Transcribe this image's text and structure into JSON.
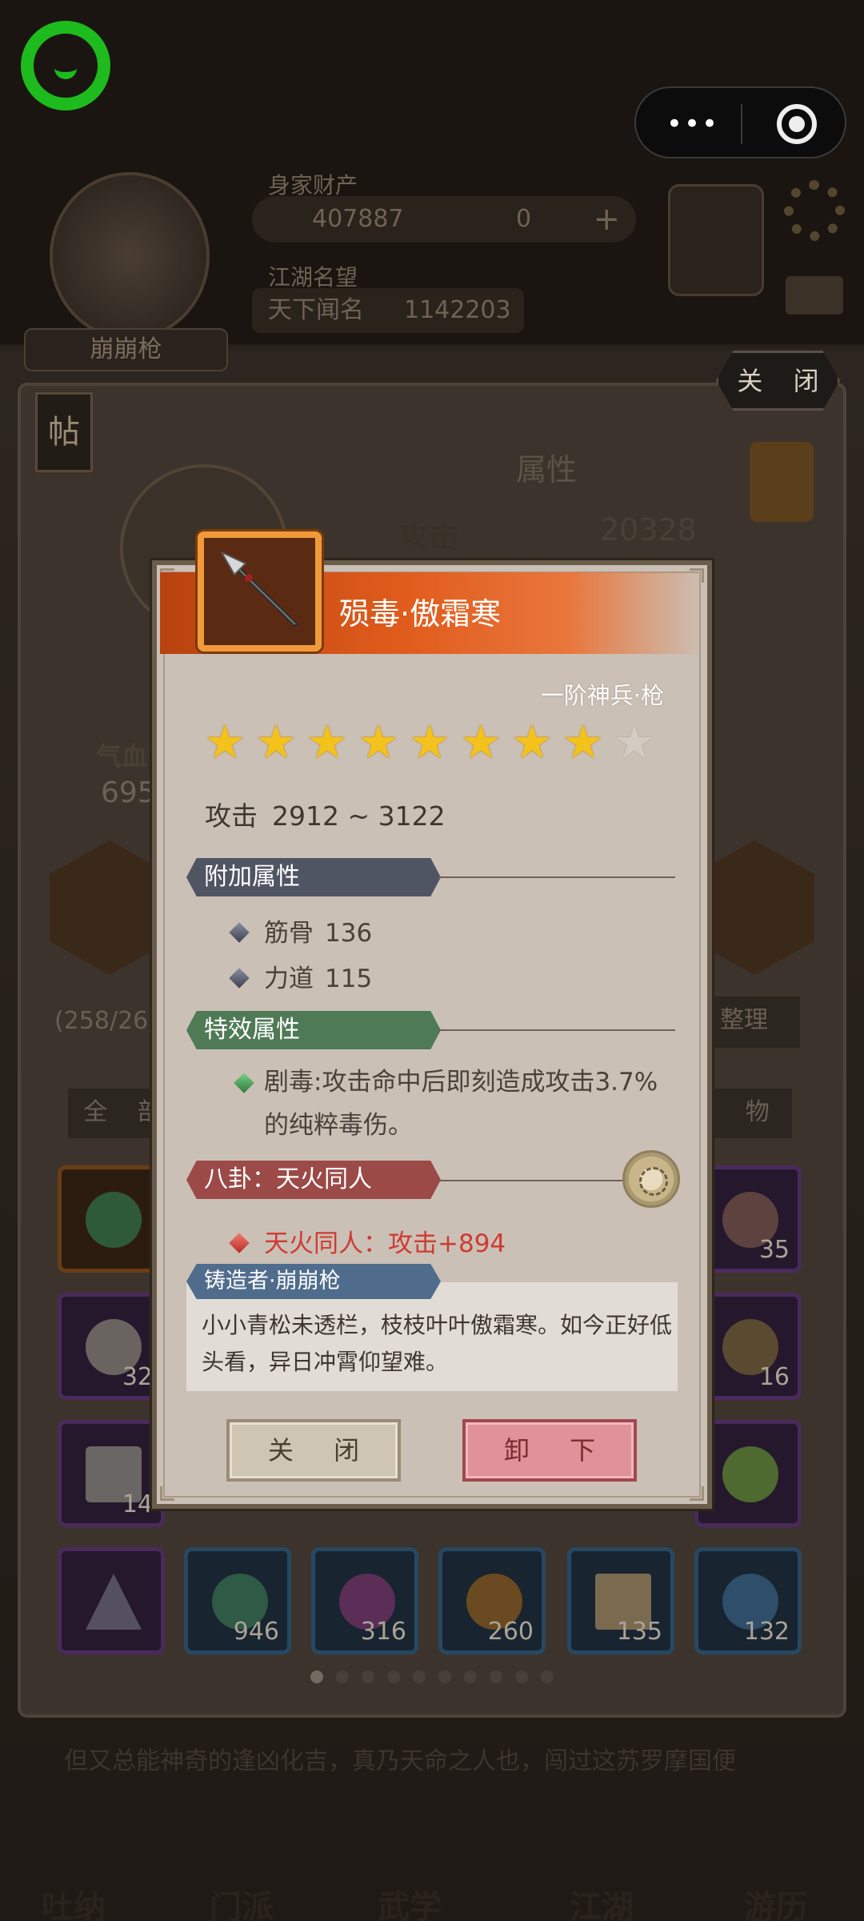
{
  "header": {
    "wealth_label": "身家财产",
    "coins": "407887",
    "gems": "0",
    "plus": "+",
    "fame_label": "江湖名望",
    "fame_title": "天下闻名",
    "fame_value": "1142203",
    "player_name": "崩崩枪",
    "menu_dots": "•••"
  },
  "panel": {
    "close_label": "关 闭",
    "tie_label": "帖",
    "attr_title": "属性",
    "attack_label": "攻击",
    "attack_value": "20328",
    "qixue_label": "气血",
    "qixue_value": "695",
    "capacity": "(258/26",
    "sort_label": "整理",
    "tab_all": "全 部",
    "tab_misc": "杂 物",
    "inventory_counts": [
      "35",
      "32",
      "16",
      "14",
      "946",
      "316",
      "260",
      "135",
      "132"
    ],
    "description": "但又总能神奇的逢凶化吉，真乃天命之人也，闯过这苏罗摩国便"
  },
  "nav": [
    "吐纳",
    "门派",
    "武学",
    "江湖",
    "游历"
  ],
  "modal": {
    "item_name": "殒毒·傲霜寒",
    "item_rank": "一阶神兵·枪",
    "stars_filled": 8,
    "stars_total": 9,
    "attack_label": "攻击",
    "attack_range": "2912 ~ 3122",
    "extra_section": "附加属性",
    "extra_attrs": [
      {
        "label": "筋骨",
        "value": "136"
      },
      {
        "label": "力道",
        "value": "115"
      }
    ],
    "special_section": "特效属性",
    "special_text": "剧毒:攻击命中后即刻造成攻击3.7%的纯粹毒伤。",
    "bagua_section": "八卦：天火同人",
    "bagua_effect": "天火同人：攻击+894",
    "maker_section": "铸造者·崩崩枪",
    "poem": "小小青松未透栏，枝枝叶叶傲霜寒。如今正好低头看，异日冲霄仰望难。",
    "close_button": "关 闭",
    "unequip_button": "卸 下"
  }
}
